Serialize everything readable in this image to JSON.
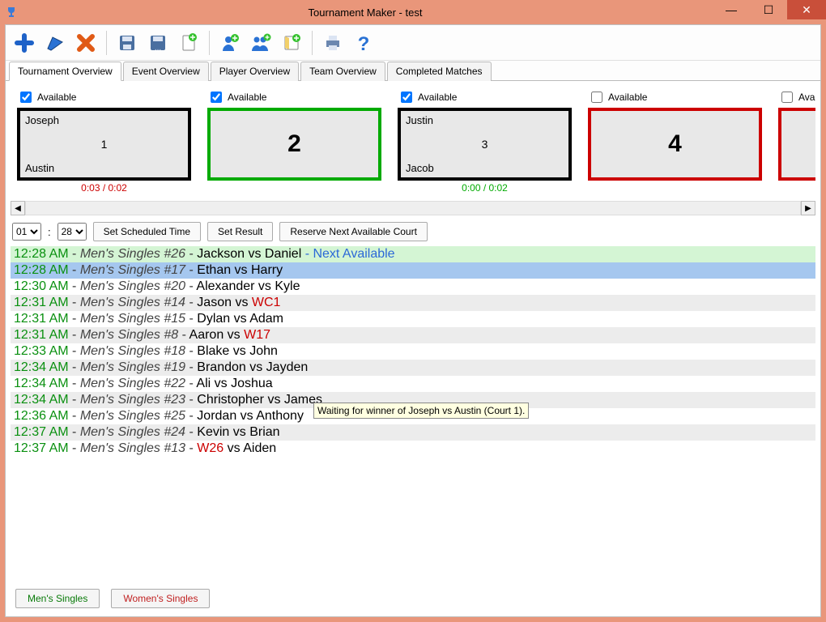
{
  "window": {
    "title": "Tournament Maker - test"
  },
  "tabs": [
    {
      "label": "Tournament Overview",
      "active": true
    },
    {
      "label": "Event Overview"
    },
    {
      "label": "Player Overview"
    },
    {
      "label": "Team Overview"
    },
    {
      "label": "Completed Matches"
    }
  ],
  "courts": {
    "available_label": "Available",
    "items": [
      {
        "checked": true,
        "border": "black",
        "num": "1",
        "p1": "Joseph",
        "p2": "Austin",
        "time": "0:03 / 0:02",
        "timecolor": "red"
      },
      {
        "checked": true,
        "border": "green",
        "num": "2",
        "p1": "",
        "p2": "",
        "time": "",
        "timecolor": ""
      },
      {
        "checked": true,
        "border": "black",
        "num": "3",
        "p1": "Justin",
        "p2": "Jacob",
        "time": "0:00 / 0:02",
        "timecolor": "green"
      },
      {
        "checked": false,
        "border": "red",
        "num": "4",
        "p1": "",
        "p2": "",
        "time": "",
        "timecolor": ""
      },
      {
        "checked": false,
        "border": "red",
        "num": "",
        "p1": "",
        "p2": "",
        "time": "",
        "timecolor": ""
      }
    ]
  },
  "schedule": {
    "selects": {
      "hour": "01",
      "minute": "28"
    },
    "buttons": {
      "set_scheduled": "Set Scheduled Time",
      "set_result": "Set Result",
      "reserve": "Reserve Next Available Court"
    }
  },
  "matches": [
    {
      "bg": "greenbg",
      "time": "12:28 AM",
      "event": "Men's Singles #26",
      "pairing": "Jackson vs Daniel",
      "next": " - Next Available"
    },
    {
      "bg": "bluebg",
      "time": "12:28 AM",
      "event": "Men's Singles #17",
      "pairing": "Ethan vs Harry"
    },
    {
      "bg": "",
      "time": "12:30 AM",
      "event": "Men's Singles #20",
      "pairing": "Alexander vs Kyle"
    },
    {
      "bg": "graybg",
      "time": "12:31 AM",
      "event": "Men's Singles #14",
      "pairing": "Jason vs ",
      "wsuffix": "WC1"
    },
    {
      "bg": "",
      "time": "12:31 AM",
      "event": "Men's Singles #15",
      "pairing": "Dylan vs Adam"
    },
    {
      "bg": "graybg",
      "time": "12:31 AM",
      "event": "Men's Singles #8",
      "pairing": "Aaron vs ",
      "wsuffix": "W17"
    },
    {
      "bg": "",
      "time": "12:33 AM",
      "event": "Men's Singles #18",
      "pairing": "Blake vs John"
    },
    {
      "bg": "graybg",
      "time": "12:34 AM",
      "event": "Men's Singles #19",
      "pairing": "Brandon vs Jayden"
    },
    {
      "bg": "",
      "time": "12:34 AM",
      "event": "Men's Singles #22",
      "pairing": "Ali vs Joshua"
    },
    {
      "bg": "graybg",
      "time": "12:34 AM",
      "event": "Men's Singles #23",
      "pairing": "Christopher vs James"
    },
    {
      "bg": "",
      "time": "12:36 AM",
      "event": "Men's Singles #25",
      "pairing": "Jordan vs Anthony"
    },
    {
      "bg": "graybg",
      "time": "12:37 AM",
      "event": "Men's Singles #24",
      "pairing": "Kevin vs Brian"
    },
    {
      "bg": "",
      "time": "12:37 AM",
      "event": "Men's Singles #13",
      "wprefix": "W26",
      "pairing2": " vs Aiden"
    }
  ],
  "tooltip": "Waiting for winner of Joseph vs Austin (Court 1).",
  "footer": {
    "mens": "Men's Singles",
    "womens": "Women's Singles"
  }
}
